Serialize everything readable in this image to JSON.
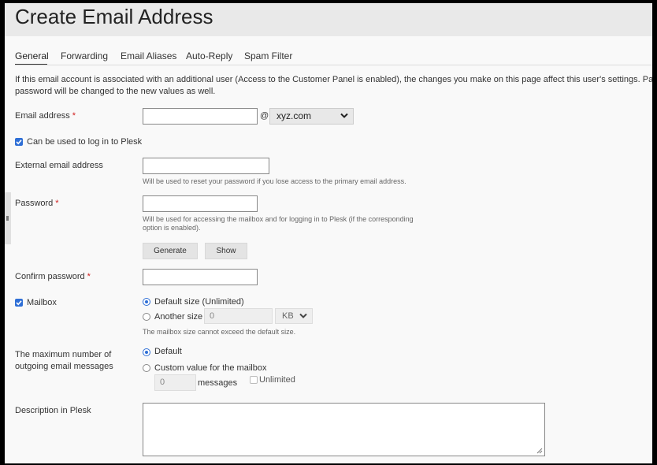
{
  "page": {
    "title": "Create Email Address"
  },
  "tabs": [
    {
      "label": "General",
      "active": true
    },
    {
      "label": "Forwarding"
    },
    {
      "label": "Email Aliases"
    },
    {
      "label": "Auto-Reply"
    },
    {
      "label": "Spam Filter"
    }
  ],
  "intro": {
    "line1": "If this email account is associated with an additional user (Access to the Customer Panel is enabled), the changes you make on this page affect this user's settings. Part",
    "line2": "password will be changed to the new values as well."
  },
  "email": {
    "label": "Email address",
    "required_mark": "*",
    "value": "",
    "at": "@",
    "domain": "xyz.com"
  },
  "login_checkbox": {
    "label": "Can be used to log in to Plesk",
    "checked": true
  },
  "external_email": {
    "label": "External email address",
    "value": "",
    "hint": "Will be used to reset your password if you lose access to the primary email address."
  },
  "password": {
    "label": "Password",
    "required_mark": "*",
    "value": "",
    "hint_line1": "Will be used for accessing the mailbox and for logging in to Plesk (if the corresponding",
    "hint_line2": "option is enabled).",
    "generate_label": "Generate",
    "show_label": "Show"
  },
  "confirm_password": {
    "label": "Confirm password",
    "required_mark": "*",
    "value": ""
  },
  "mailbox": {
    "label": "Mailbox",
    "checked": true,
    "default_option": "Default size (Unlimited)",
    "another_option": "Another size",
    "size_value": "0",
    "size_unit": "KB",
    "hint": "The mailbox size cannot exceed the default size."
  },
  "outgoing": {
    "label_line1": "The maximum number of",
    "label_line2": "outgoing email messages",
    "default_option": "Default",
    "custom_option": "Custom value for the mailbox",
    "value": "0",
    "unit": "messages",
    "unlimited_label": "Unlimited"
  },
  "description": {
    "label": "Description in Plesk",
    "value": ""
  },
  "colors": {
    "accent": "#2f6fd6",
    "required": "#d02020"
  }
}
